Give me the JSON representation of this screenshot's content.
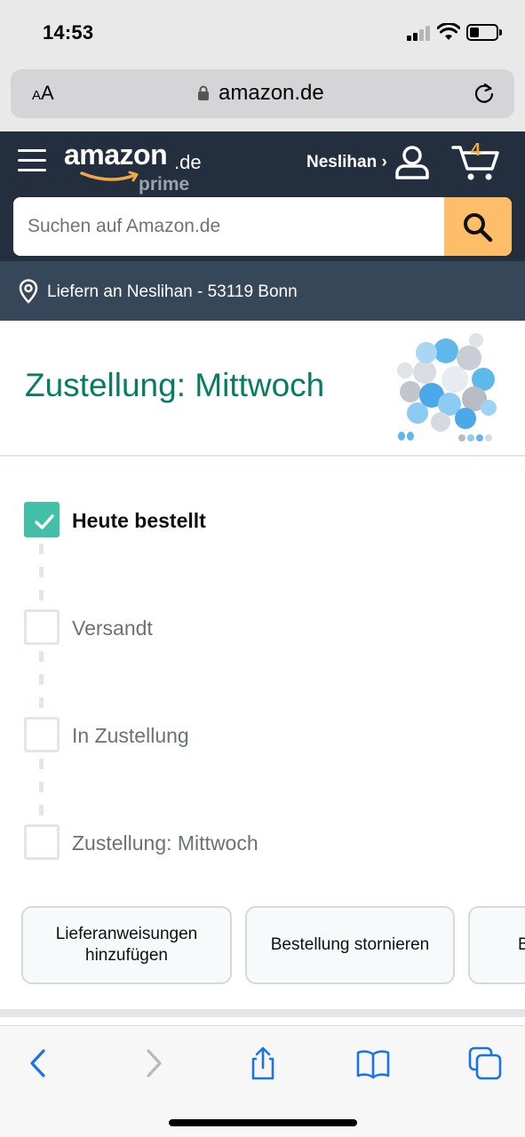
{
  "status_bar": {
    "time": "14:53",
    "battery_level": 0.35
  },
  "browser": {
    "text_size_label_small": "A",
    "text_size_label_large": "A",
    "url": "amazon.de"
  },
  "header": {
    "logo_text": "amazon",
    "logo_tld": ".de",
    "logo_sub": "prime",
    "account_label": "Neslihan ›",
    "cart_count": "4",
    "search_placeholder": "Suchen auf Amazon.de",
    "deliver_to": "Liefern an Neslihan - 53119 Bonn"
  },
  "delivery": {
    "title": "Zustellung: Mittwoch",
    "steps": [
      {
        "label": "Heute bestellt",
        "done": true
      },
      {
        "label": "Versandt",
        "done": false
      },
      {
        "label": "In Zustellung",
        "done": false
      },
      {
        "label": "Zustellung: Mittwoch",
        "done": false
      }
    ]
  },
  "actions": [
    {
      "label": "Lieferanweisungen hinzufügen"
    },
    {
      "label": "Bestellung stornieren"
    },
    {
      "label": "B"
    }
  ],
  "colors": {
    "header_bg": "#232f3e",
    "deliver_bar_bg": "#37475a",
    "accent_green": "#067d62",
    "check_green": "#43bfa8",
    "search_button": "#febd69",
    "cart_count": "#f3a847",
    "safari_blue": "#1a73e8"
  },
  "icons": {
    "menu": "hamburger-icon",
    "account": "user-icon",
    "cart": "cart-icon",
    "search": "search-icon",
    "location": "location-pin-icon",
    "back": "chevron-left-icon",
    "forward": "chevron-right-icon",
    "share": "share-icon",
    "bookmarks": "book-icon",
    "tabs": "tabs-icon"
  }
}
